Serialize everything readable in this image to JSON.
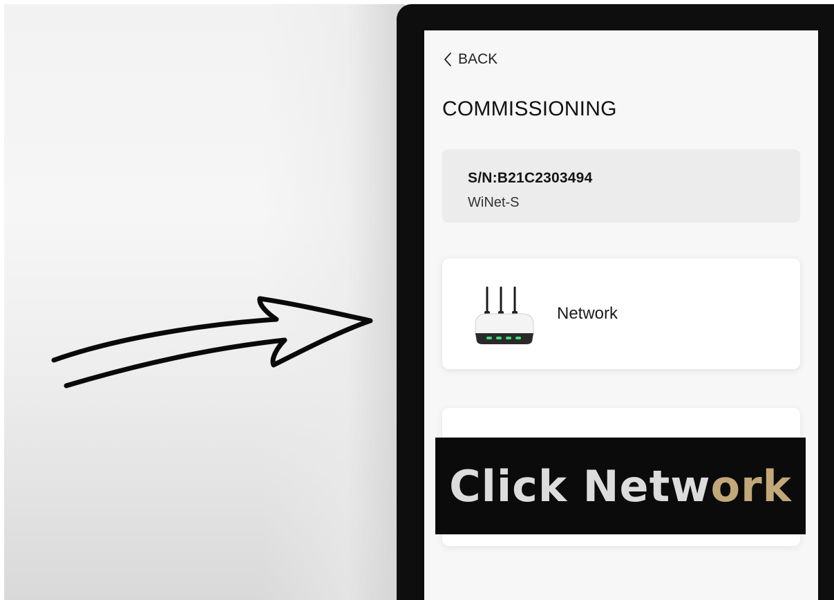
{
  "app": {
    "back_label": "BACK",
    "page_title": "COMMISSIONING"
  },
  "device": {
    "serial": "S/N:B21C2303494",
    "model": "WiNet-S"
  },
  "menu": {
    "network_label": "Network",
    "network_icon": "router-icon"
  },
  "overlay": {
    "caption_main": "Click Netw",
    "caption_accent": "ork",
    "accent_color": "#c2a878",
    "caption_color": "#dcdcdc"
  },
  "annotation": {
    "arrow_icon": "hand-drawn-arrow-icon"
  }
}
